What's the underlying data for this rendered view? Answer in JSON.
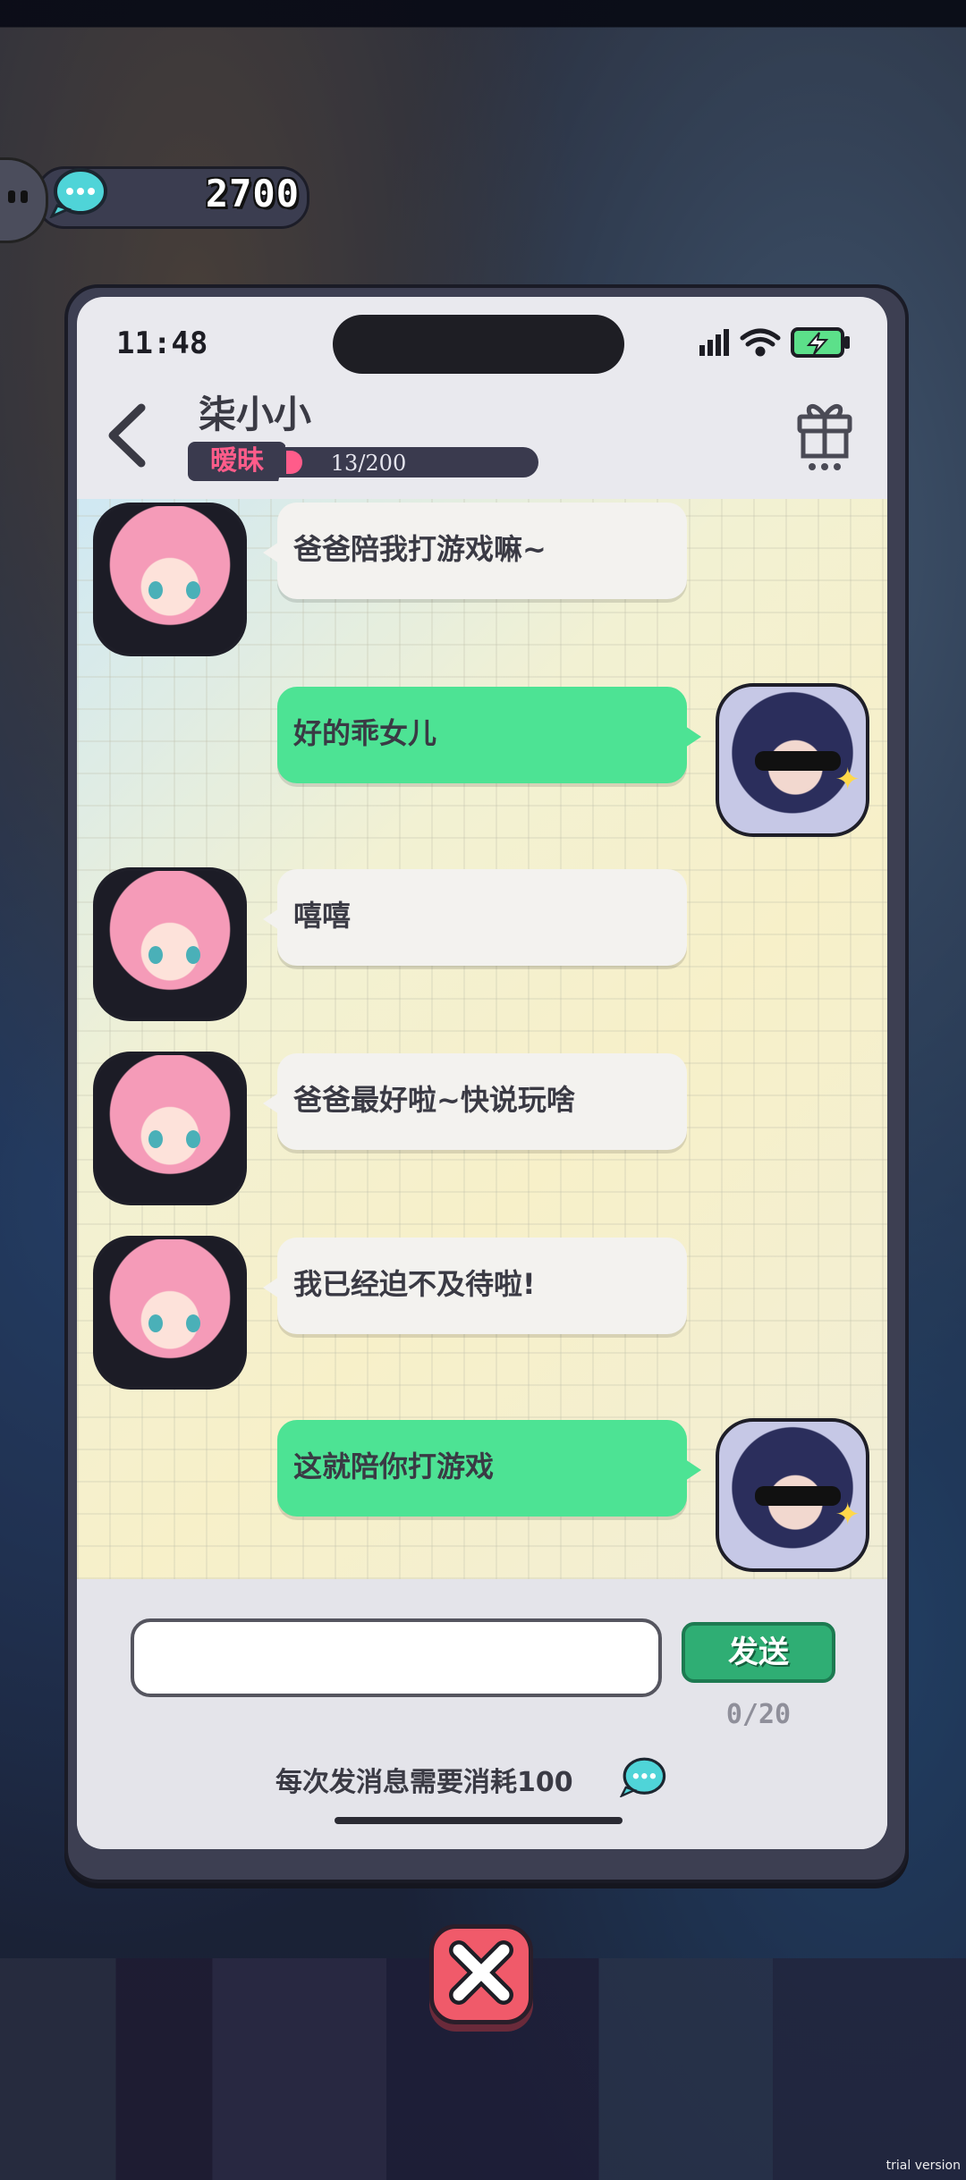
{
  "hud": {
    "currency_value": "2700"
  },
  "phone": {
    "time": "11:48",
    "contact_name": "柒小小",
    "intimacy_label": "暧昧",
    "intimacy_progress": "13/200",
    "intimacy_fraction": 0.065
  },
  "messages": [
    {
      "from": "her",
      "text": "爸爸陪我打游戏嘛~"
    },
    {
      "from": "me",
      "text": "好的乖女儿"
    },
    {
      "from": "her",
      "text": "嘻嘻"
    },
    {
      "from": "her",
      "text": "爸爸最好啦~快说玩啥"
    },
    {
      "from": "her",
      "text": "我已经迫不及待啦!"
    },
    {
      "from": "me",
      "text": "这就陪你打游戏"
    }
  ],
  "composer": {
    "input_value": "",
    "send_label": "发送",
    "char_counter": "0/20",
    "cost_note": "每次发消息需要消耗100"
  },
  "watermark": "trial version",
  "colors": {
    "outgoing_bubble": "#4de394",
    "incoming_bubble": "#f3f2ef",
    "send_button": "#2fae74",
    "intimacy_accent": "#ff5c8a",
    "close_button": "#f05a6a"
  }
}
